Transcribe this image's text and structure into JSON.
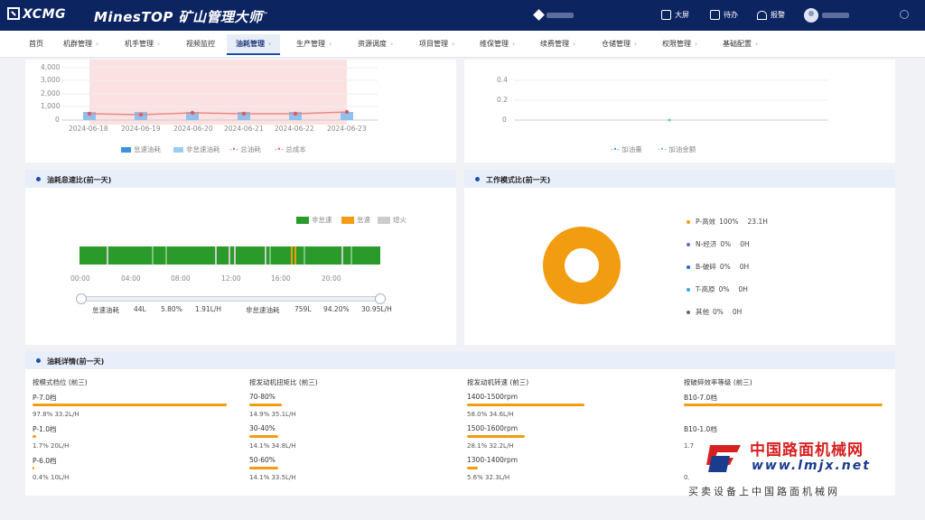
{
  "header": {
    "brand": "XCMG",
    "app_title": "MinesTOP 矿山管理大师",
    "screen_label": "大屏",
    "todo_label": "待办",
    "alarm_label": "报警"
  },
  "nav": [
    "首页",
    "机群管理",
    "机手管理",
    "视频监控",
    "油耗管理",
    "生产管理",
    "资源调度",
    "项目管理",
    "维保管理",
    "续费管理",
    "仓储管理",
    "权限管理",
    "基础配置"
  ],
  "nav_active_index": 4,
  "top_left_chart": {
    "y_ticks": [
      "4,000",
      "3,000",
      "2,000",
      "1,000",
      "0"
    ],
    "x_ticks": [
      "2024-06-18",
      "2024-06-19",
      "2024-06-20",
      "2024-06-21",
      "2024-06-22",
      "2024-06-23"
    ],
    "legend": [
      "怠速油耗",
      "非怠速油耗",
      "总油耗",
      "总成本"
    ]
  },
  "top_right_chart": {
    "y_ticks": [
      "0.4",
      "0.2",
      "0"
    ],
    "legend": [
      "加油量",
      "加油金额"
    ]
  },
  "idle_panel": {
    "title": "油耗怠速比(前一天)",
    "legend": [
      "非怠速",
      "怠速",
      "熄火"
    ],
    "time_ticks": [
      "00:00",
      "04:00",
      "08:00",
      "12:00",
      "16:00",
      "20:00"
    ],
    "stats": {
      "idle_label": "怠速油耗",
      "idle_fuel": "44L",
      "idle_pct": "5.80%",
      "idle_rate": "1.91L/H",
      "nonidle_label": "非怠速油耗",
      "nonidle_fuel": "759L",
      "nonidle_pct": "94.20%",
      "nonidle_rate": "30.95L/H"
    }
  },
  "mode_panel": {
    "title": "工作模式比(前一天)",
    "items": [
      {
        "name": "P-高效",
        "pct": "100%",
        "hours": "23.1H",
        "color": "#f29c11"
      },
      {
        "name": "N-经济",
        "pct": "0%",
        "hours": "0H",
        "color": "#5b6bd6"
      },
      {
        "name": "B-破碎",
        "pct": "0%",
        "hours": "0H",
        "color": "#1e6ad8"
      },
      {
        "name": "T-高原",
        "pct": "0%",
        "hours": "0H",
        "color": "#36a9e1"
      },
      {
        "name": "其他",
        "pct": "0%",
        "hours": "0H",
        "color": "#666666"
      }
    ],
    "pie_value": 100
  },
  "detail_panel": {
    "title": "油耗详情(前一天)",
    "columns": [
      {
        "title": "按模式档位 (前三)",
        "items": [
          {
            "name": "P-7.0档",
            "pct": "97.8%",
            "rate": "33.2L/H",
            "share": 0.978
          },
          {
            "name": "P-1.0档",
            "pct": "1.7%",
            "rate": "20L/H",
            "share": 0.017
          },
          {
            "name": "P-6.0档",
            "pct": "0.4%",
            "rate": "10L/H",
            "share": 0.004
          }
        ]
      },
      {
        "title": "按发动机扭矩比 (前三)",
        "items": [
          {
            "name": "70-80%",
            "pct": "14.9%",
            "rate": "35.1L/H",
            "share": 0.149
          },
          {
            "name": "30-40%",
            "pct": "14.1%",
            "rate": "34.8L/H",
            "share": 0.141
          },
          {
            "name": "50-60%",
            "pct": "14.1%",
            "rate": "33.5L/H",
            "share": 0.141
          }
        ]
      },
      {
        "title": "按发动机转速 (前三)",
        "items": [
          {
            "name": "1400-1500rpm",
            "pct": "58.0%",
            "rate": "34.6L/H",
            "share": 0.58
          },
          {
            "name": "1500-1600rpm",
            "pct": "28.1%",
            "rate": "32.2L/H",
            "share": 0.281
          },
          {
            "name": "1300-1400rpm",
            "pct": "5.6%",
            "rate": "32.3L/H",
            "share": 0.056
          }
        ]
      },
      {
        "title": "按破碎效率等级 (前三)",
        "items": [
          {
            "name": "B10-7.0档",
            "pct": "",
            "rate": "",
            "share": 0.95
          },
          {
            "name": "B10-1.0档",
            "pct": "1.7",
            "rate": "",
            "share": 0.0
          },
          {
            "name": "",
            "pct": "0.",
            "rate": "",
            "share": 0.0
          }
        ]
      }
    ]
  },
  "watermark": {
    "line1": "中国路面机械网",
    "line2": "www.lmjx.net",
    "line3": "买卖设备上中国路面机械网"
  }
}
